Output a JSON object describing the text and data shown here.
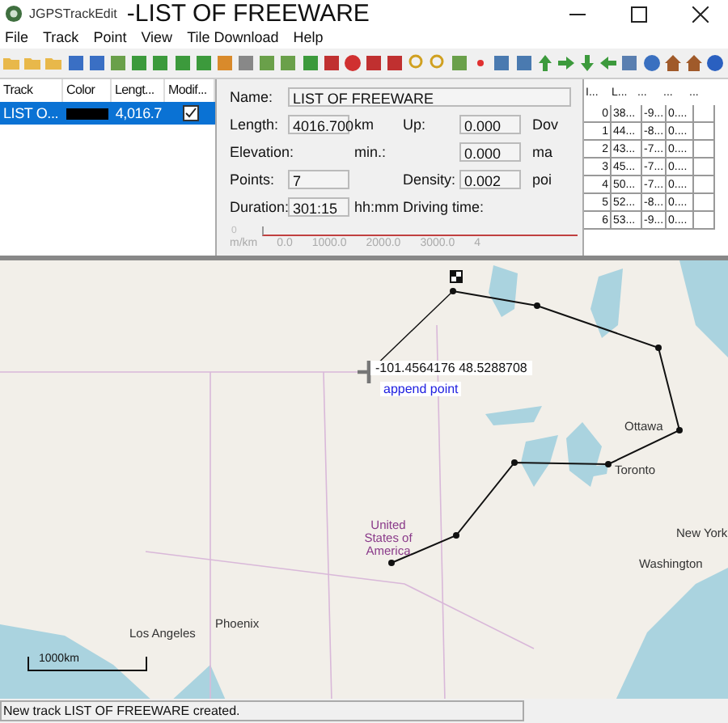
{
  "window": {
    "app_name": "JGPSTrackEdit",
    "title": "-LIST OF FREEWARE"
  },
  "menu": [
    "File",
    "Track",
    "Point",
    "View",
    "Tile Download",
    "Help"
  ],
  "tracks": {
    "columns": [
      "Track",
      "Color",
      "Lengt...",
      "Modif..."
    ],
    "rows": [
      {
        "name": "LIST O...",
        "color": "#000000",
        "length": "4,016.7",
        "modified": true,
        "selected": true
      }
    ]
  },
  "info": {
    "name_label": "Name:",
    "name": "LIST OF FREEWARE",
    "rows": [
      {
        "label": "Length:",
        "value": "4016.700",
        "unit": "km",
        "label2": "Up:",
        "value2": "0.000",
        "label3": "Dov"
      },
      {
        "label": "Elevation:",
        "value": null,
        "unit": "min.:",
        "label2": "",
        "value2": "0.000",
        "label3": "ma"
      },
      {
        "label": "Points:",
        "value": "7",
        "unit": "",
        "label2": "Density:",
        "value2": "0.002",
        "label3": "poi"
      },
      {
        "label": "Duration:",
        "value": "301:15",
        "unit": "hh:mm",
        "label2": "Driving time:",
        "value2": null,
        "label3": ""
      }
    ],
    "profile": {
      "y_label": "0",
      "unit": "m/km",
      "x_ticks": [
        "0.0",
        "1000.0",
        "2000.0",
        "3000.0",
        "4"
      ]
    }
  },
  "points": {
    "columns": [
      "I...",
      "L...",
      "...",
      "...",
      "..."
    ],
    "rows": [
      [
        "0",
        "38...",
        "-9...",
        "0...."
      ],
      [
        "1",
        "44...",
        "-8...",
        "0...."
      ],
      [
        "2",
        "43...",
        "-7...",
        "0...."
      ],
      [
        "3",
        "45...",
        "-7...",
        "0...."
      ],
      [
        "4",
        "50...",
        "-7...",
        "0...."
      ],
      [
        "5",
        "52...",
        "-8...",
        "0...."
      ],
      [
        "6",
        "53...",
        "-9...",
        "0...."
      ]
    ]
  },
  "map": {
    "cursor_coords": "-101.4564176 48.5288708",
    "cursor_hint": "append point",
    "scale": "1000km",
    "labels": [
      "Ottawa",
      "Toronto",
      "New York",
      "Washington",
      "United States of America",
      "Phoenix",
      "Los Angeles"
    ]
  },
  "status_bar": "New track LIST OF FREEWARE created."
}
